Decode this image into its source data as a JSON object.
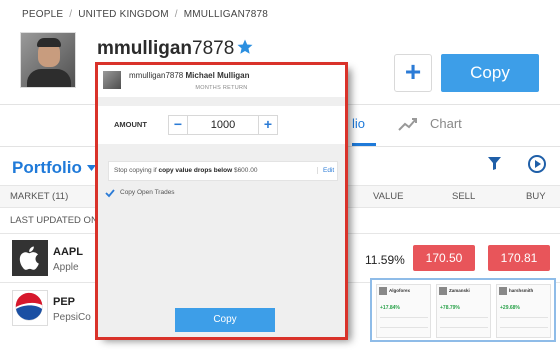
{
  "breadcrumb": [
    "PEOPLE",
    "UNITED KINGDOM",
    "MMULLIGAN7878"
  ],
  "breadcrumb_sep": "/",
  "profile": {
    "username_text": "mmulligan",
    "username_num": "7878",
    "copy_label": "Copy",
    "plus_label": "+"
  },
  "tabs": {
    "portfolio_partial": "lio",
    "chart": "Chart"
  },
  "portfolio": {
    "title": "Portfolio"
  },
  "columns": {
    "market": "MARKET (11)",
    "value": "VALUE",
    "sell": "SELL",
    "buy": "BUY"
  },
  "last_updated": "LAST UPDATED ON: 2",
  "rows": [
    {
      "ticker": "AAPL",
      "company": "Apple",
      "pct": "11.59%",
      "sell": "170.50",
      "buy": "170.81"
    },
    {
      "ticker": "PEP",
      "company": "PepsiCo"
    }
  ],
  "social_cards": [
    {
      "name": "Algoforex",
      "gain": "+17.84%"
    },
    {
      "name": "Zamanski",
      "gain": "+78.79%"
    },
    {
      "name": "harshsmith",
      "gain": "+29.68%"
    }
  ],
  "modal": {
    "user_handle": "mmulligan7878",
    "user_name": "Michael Mulligan",
    "months_return": "MONTHS RETURN",
    "amount_label": "AMOUNT",
    "amount_value": "1000",
    "minus": "−",
    "plus": "+",
    "stop_prefix": "Stop copying if",
    "stop_bold": "copy value drops below",
    "stop_value": "$600.00",
    "edit": "Edit",
    "copy_open_trades": "Copy Open Trades",
    "copy_button": "Copy"
  },
  "colors": {
    "accent": "#3d9ee8",
    "sell": "#e8555a",
    "modal_border": "#d9322a",
    "link": "#1f7ad9"
  }
}
